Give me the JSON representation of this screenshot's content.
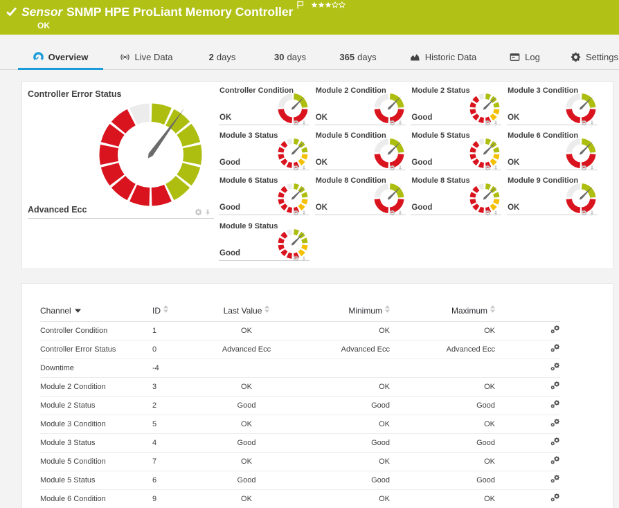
{
  "colors": {
    "header_bg": "#b1c116",
    "gauge_green": "#adbe10",
    "gauge_red": "#d9141e",
    "gauge_yellow": "#f5c003",
    "gauge_gray": "#ececec",
    "needle": "#6b6b6b",
    "active_tab_blue": "#1b9cd9"
  },
  "header": {
    "status_icon": "check-icon",
    "kind_label": "Sensor",
    "title": "SNMP HPE ProLiant Memory Controller",
    "status": "OK",
    "rating": {
      "filled": 3,
      "total": 5
    }
  },
  "tabs": [
    {
      "label": "Overview",
      "icon": "gauge-icon",
      "active": true
    },
    {
      "label": "Live Data",
      "icon": "broadcast-icon",
      "active": false
    },
    {
      "num": "2",
      "label": "days",
      "active": false
    },
    {
      "num": "30",
      "label": "days",
      "active": false
    },
    {
      "num": "365",
      "label": "days",
      "active": false
    },
    {
      "label": "Historic Data",
      "icon": "chart-icon",
      "active": false
    },
    {
      "label": "Log",
      "icon": "log-icon",
      "active": false
    },
    {
      "label": "Settings",
      "icon": "gear-icon",
      "active": false
    }
  ],
  "chart_data": {
    "type": "gauges",
    "primary_gauge": {
      "title": "Controller Error Status",
      "value": "Advanced Ecc",
      "style": "big",
      "needle_deg": 36
    },
    "channel_gauges": [
      {
        "title": "Controller Condition",
        "value": "OK",
        "style": "condition",
        "needle_deg": 45
      },
      {
        "title": "Module 2 Condition",
        "value": "OK",
        "style": "condition",
        "needle_deg": 45
      },
      {
        "title": "Module 2 Status",
        "value": "Good",
        "style": "status",
        "needle_deg": 45
      },
      {
        "title": "Module 3 Condition",
        "value": "OK",
        "style": "condition",
        "needle_deg": 45
      },
      {
        "title": "Module 3 Status",
        "value": "Good",
        "style": "status",
        "needle_deg": 45
      },
      {
        "title": "Module 5 Condition",
        "value": "OK",
        "style": "condition",
        "needle_deg": 45
      },
      {
        "title": "Module 5 Status",
        "value": "Good",
        "style": "status",
        "needle_deg": 45
      },
      {
        "title": "Module 6 Condition",
        "value": "OK",
        "style": "condition",
        "needle_deg": 45
      },
      {
        "title": "Module 6 Status",
        "value": "Good",
        "style": "status",
        "needle_deg": 45
      },
      {
        "title": "Module 8 Condition",
        "value": "OK",
        "style": "condition",
        "needle_deg": 45
      },
      {
        "title": "Module 8 Status",
        "value": "Good",
        "style": "status",
        "needle_deg": 45
      },
      {
        "title": "Module 9 Condition",
        "value": "OK",
        "style": "condition",
        "needle_deg": 45
      },
      {
        "title": "Module 9 Status",
        "value": "Good",
        "style": "status",
        "needle_deg": 45
      }
    ],
    "gauge_styles": {
      "big": {
        "outer_r": 74,
        "inner_r": 47.5,
        "gap_deg": 3,
        "needle_len": 83,
        "needle_w": 7,
        "segments": [
          [
            "green",
            6
          ],
          [
            "red",
            7
          ],
          [
            "gray",
            1
          ]
        ]
      },
      "condition": {
        "outer_r": 21.5,
        "inner_r": 13,
        "gap_deg": 8,
        "needle_len": 24.5,
        "needle_w": 3.4,
        "segments": [
          [
            "green",
            1
          ],
          [
            "red",
            2
          ],
          [
            "gray",
            1
          ]
        ]
      },
      "status": {
        "outer_r": 21.5,
        "inner_r": 13.5,
        "gap_deg": 9,
        "needle_len": 24.5,
        "needle_w": 3.4,
        "segments": [
          [
            "green",
            3
          ],
          [
            "yellow",
            2
          ],
          [
            "red",
            6
          ],
          [
            "gray",
            1
          ]
        ]
      }
    }
  },
  "table": {
    "columns": [
      {
        "label": "Channel",
        "sort": "down",
        "align": "left"
      },
      {
        "label": "ID",
        "sort": "both",
        "align": "left"
      },
      {
        "label": "Last Value",
        "sort": "both",
        "align": "center"
      },
      {
        "label": "Minimum",
        "sort": "both",
        "align": "right"
      },
      {
        "label": "Maximum",
        "sort": "both",
        "align": "right"
      },
      {
        "label": "",
        "sort": "none",
        "align": "right"
      }
    ],
    "rows": [
      [
        "Controller Condition",
        "1",
        "OK",
        "OK",
        "OK"
      ],
      [
        "Controller Error Status",
        "0",
        "Advanced Ecc",
        "Advanced Ecc",
        "Advanced Ecc"
      ],
      [
        "Downtime",
        "-4",
        "",
        "",
        ""
      ],
      [
        "Module 2 Condition",
        "3",
        "OK",
        "OK",
        "OK"
      ],
      [
        "Module 2 Status",
        "2",
        "Good",
        "Good",
        "Good"
      ],
      [
        "Module 3 Condition",
        "5",
        "OK",
        "OK",
        "OK"
      ],
      [
        "Module 3 Status",
        "4",
        "Good",
        "Good",
        "Good"
      ],
      [
        "Module 5 Condition",
        "7",
        "OK",
        "OK",
        "OK"
      ],
      [
        "Module 5 Status",
        "6",
        "Good",
        "Good",
        "Good"
      ],
      [
        "Module 6 Condition",
        "9",
        "OK",
        "OK",
        "OK"
      ]
    ]
  }
}
